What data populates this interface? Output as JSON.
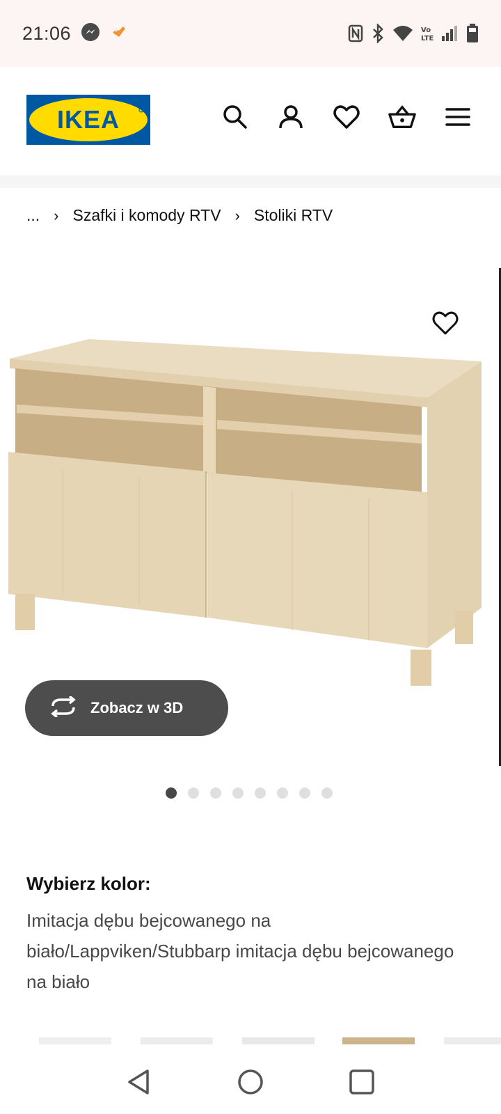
{
  "status_bar": {
    "time": "21:06",
    "left_icons": [
      "messenger-icon",
      "orange-app-icon"
    ],
    "right_icons": [
      "nfc-icon",
      "bluetooth-icon",
      "wifi-icon",
      "volte-icon",
      "signal-icon",
      "battery-icon"
    ]
  },
  "header": {
    "logo_text": "IKEA",
    "icons": [
      "search-icon",
      "profile-icon",
      "wishlist-icon",
      "cart-icon",
      "menu-icon"
    ],
    "colors": {
      "logo_blue": "#0058a3",
      "logo_yellow": "#ffdb00"
    }
  },
  "breadcrumb": {
    "ellipsis": "...",
    "items": [
      "Szafki i komody RTV",
      "Stoliki RTV"
    ]
  },
  "product": {
    "view3d_label": "Zobacz w 3D",
    "image_count": 8,
    "active_image": 1,
    "color_heading": "Wybierz kolor:",
    "color_value": "Imitacja dębu bejcowanego na biało/Lappviken/Stubbarp imitacja dębu bejcowanego na biało"
  },
  "nav_bar": {
    "icons": [
      "back-icon",
      "home-icon",
      "recents-icon"
    ]
  }
}
